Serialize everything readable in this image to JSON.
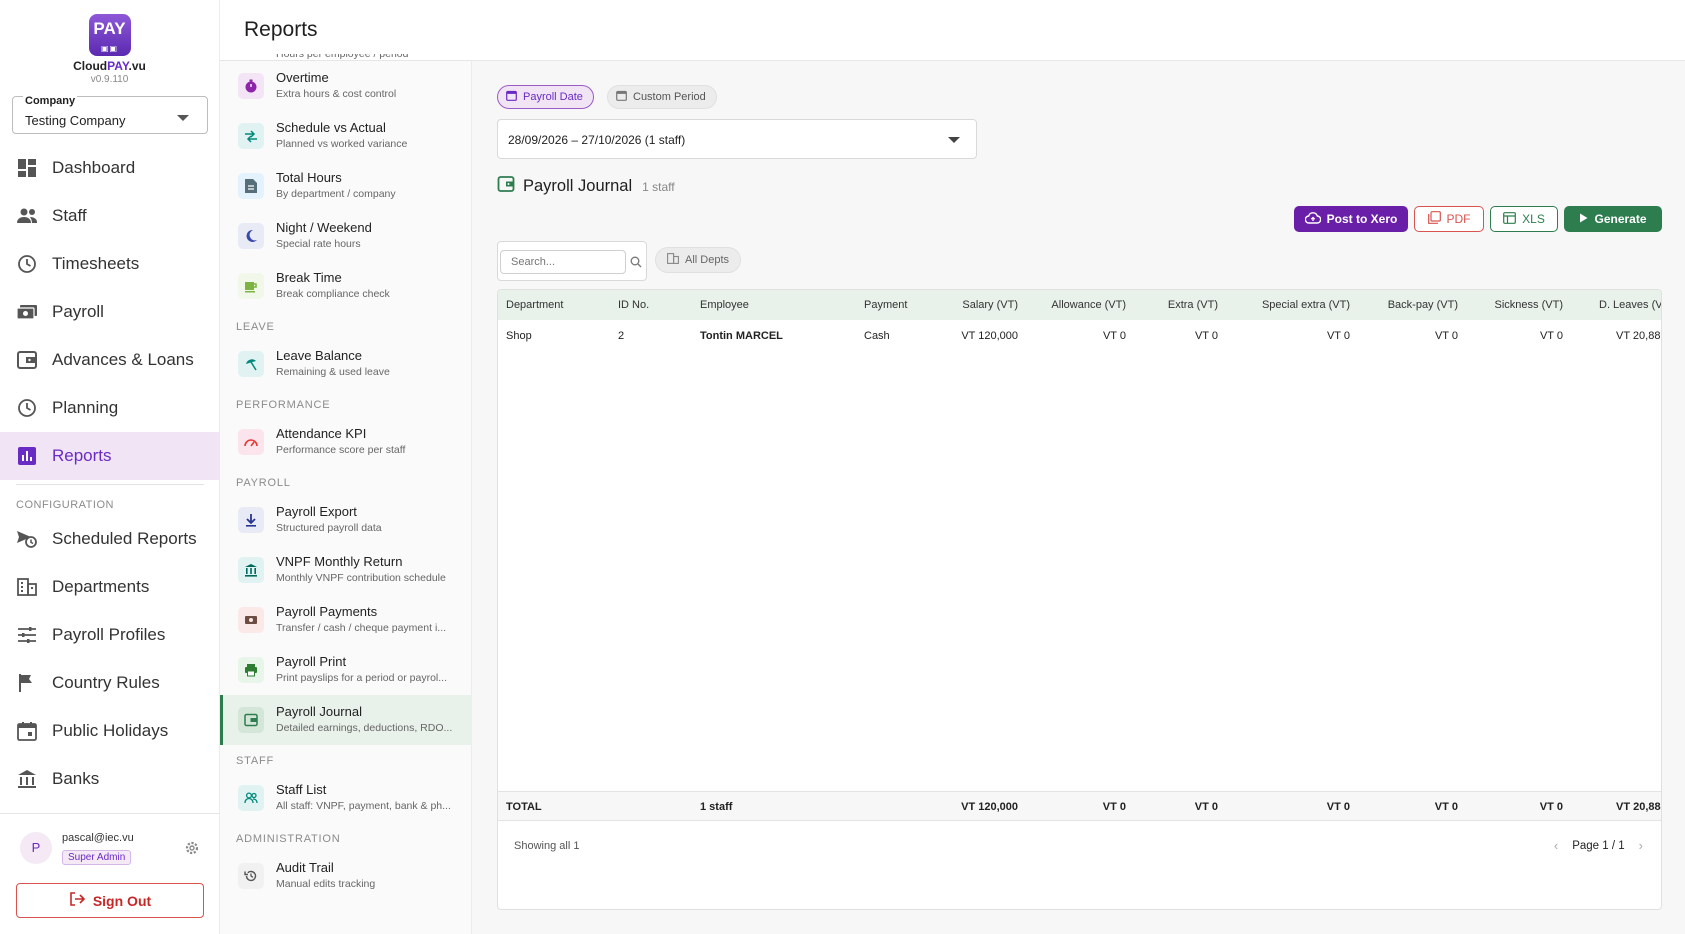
{
  "app": {
    "logo_text": "PAY",
    "brand_prefix": "Cloud",
    "brand_accent": "PAY",
    "brand_suffix": ".vu",
    "version": "v0.9.110",
    "accent_color": "#6a2bc5",
    "green_color": "#2e7d4f"
  },
  "company": {
    "label": "Company",
    "value": "Testing Company"
  },
  "nav": {
    "items": [
      {
        "label": "Dashboard",
        "icon": "dashboard-icon"
      },
      {
        "label": "Staff",
        "icon": "people-icon"
      },
      {
        "label": "Timesheets",
        "icon": "clock-icon"
      },
      {
        "label": "Payroll",
        "icon": "money-icon"
      },
      {
        "label": "Advances & Loans",
        "icon": "wallet-icon"
      },
      {
        "label": "Planning",
        "icon": "clock-icon"
      },
      {
        "label": "Reports",
        "icon": "bar-chart-icon"
      }
    ],
    "config_title": "CONFIGURATION",
    "config_items": [
      {
        "label": "Scheduled Reports",
        "icon": "schedule-send-icon"
      },
      {
        "label": "Departments",
        "icon": "building-icon"
      },
      {
        "label": "Payroll Profiles",
        "icon": "sliders-icon"
      },
      {
        "label": "Country Rules",
        "icon": "flag-icon"
      },
      {
        "label": "Public Holidays",
        "icon": "calendar-icon"
      },
      {
        "label": "Banks",
        "icon": "bank-icon"
      }
    ]
  },
  "user": {
    "initial": "P",
    "email": "pascal@iec.vu",
    "role": "Super Admin",
    "signout_label": "Sign Out"
  },
  "page": {
    "title": "Reports"
  },
  "reports": {
    "partial_top_subtitle": "Hours per employee / period",
    "items_a": [
      {
        "title": "Overtime",
        "subtitle": "Extra hours & cost control"
      },
      {
        "title": "Schedule vs Actual",
        "subtitle": "Planned vs worked variance"
      },
      {
        "title": "Total Hours",
        "subtitle": "By department / company"
      },
      {
        "title": "Night / Weekend",
        "subtitle": "Special rate hours"
      },
      {
        "title": "Break Time",
        "subtitle": "Break compliance check"
      }
    ],
    "group_leave": "LEAVE",
    "items_leave": [
      {
        "title": "Leave Balance",
        "subtitle": "Remaining & used leave"
      }
    ],
    "group_performance": "PERFORMANCE",
    "items_performance": [
      {
        "title": "Attendance KPI",
        "subtitle": "Performance score per staff"
      }
    ],
    "group_payroll": "PAYROLL",
    "items_payroll": [
      {
        "title": "Payroll Export",
        "subtitle": "Structured payroll data"
      },
      {
        "title": "VNPF Monthly Return",
        "subtitle": "Monthly VNPF contribution schedule"
      },
      {
        "title": "Payroll Payments",
        "subtitle": "Transfer / cash / cheque payment i..."
      },
      {
        "title": "Payroll Print",
        "subtitle": "Print payslips for a period or payrol..."
      },
      {
        "title": "Payroll Journal",
        "subtitle": "Detailed earnings, deductions, RDO..."
      }
    ],
    "group_staff": "STAFF",
    "items_staff": [
      {
        "title": "Staff List",
        "subtitle": "All staff: VNPF, payment, bank & ph..."
      }
    ],
    "group_admin": "ADMINISTRATION",
    "items_admin": [
      {
        "title": "Audit Trail",
        "subtitle": "Manual edits tracking"
      }
    ]
  },
  "filters": {
    "payroll_date": "Payroll Date",
    "custom_period": "Custom Period",
    "period_value": "28/09/2026 – 27/10/2026  (1 staff)",
    "search_placeholder": "Search...",
    "dept_filter": "All Depts"
  },
  "section": {
    "title": "Payroll Journal",
    "count": "1 staff"
  },
  "actions": {
    "xero": "Post to Xero",
    "pdf": "PDF",
    "xls": "XLS",
    "generate": "Generate"
  },
  "table": {
    "headers": [
      "Department",
      "ID No.",
      "Employee",
      "Payment",
      "Salary (VT)",
      "Allowance (VT)",
      "Extra (VT)",
      "Special extra (VT)",
      "Back-pay (VT)",
      "Sickness (VT)",
      "D. Leaves (VT)"
    ],
    "rows": [
      [
        "Shop",
        "2",
        "Tontin MARCEL",
        "Cash",
        "VT 120,000",
        "VT 0",
        "VT 0",
        "VT 0",
        "VT 0",
        "VT 0",
        "VT 20,88"
      ]
    ],
    "total": [
      "TOTAL",
      "",
      "1 staff",
      "",
      "VT 120,000",
      "VT 0",
      "VT 0",
      "VT 0",
      "VT 0",
      "VT 0",
      "VT 20,88"
    ]
  },
  "footer": {
    "showing": "Showing all 1",
    "page": "Page 1 / 1"
  }
}
